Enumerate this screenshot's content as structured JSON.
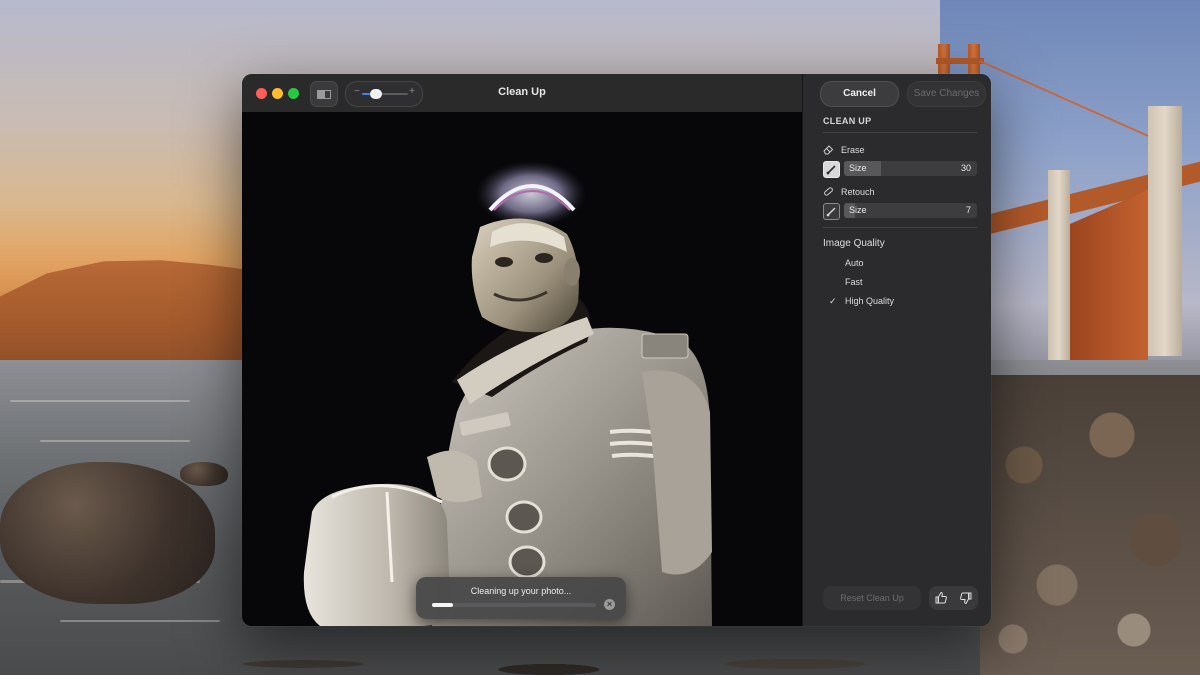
{
  "window": {
    "title": "Clean Up"
  },
  "toolbar": {
    "zoom_minus": "−",
    "zoom_plus": "+",
    "zoom_level": 0.18
  },
  "sidebar": {
    "cancel_label": "Cancel",
    "save_label": "Save Changes",
    "section_title": "CLEAN UP",
    "erase": {
      "label": "Erase",
      "size_label": "Size",
      "size_value": "30",
      "size_fraction": 0.28
    },
    "retouch": {
      "label": "Retouch",
      "size_label": "Size",
      "size_value": "7",
      "size_fraction": 0.08
    },
    "image_quality": {
      "label": "Image Quality",
      "options": [
        {
          "label": "Auto",
          "selected": false
        },
        {
          "label": "Fast",
          "selected": false
        },
        {
          "label": "High Quality",
          "selected": true
        }
      ],
      "check": "✓"
    },
    "reset_label": "Reset Clean Up"
  },
  "progress": {
    "text": "Cleaning up your photo...",
    "fraction": 0.13,
    "cancel_glyph": "×"
  },
  "colors": {
    "close": "#ff5f57",
    "minimize": "#febc2e",
    "zoom": "#28c840",
    "accent": "#3b82f6",
    "sidebar_bg": "#2b2b2d"
  },
  "icons": [
    "view-toggle-icon",
    "eraser-icon",
    "retouch-bandage-icon",
    "brush-icon",
    "thumbs-up-icon",
    "thumbs-down-icon"
  ]
}
